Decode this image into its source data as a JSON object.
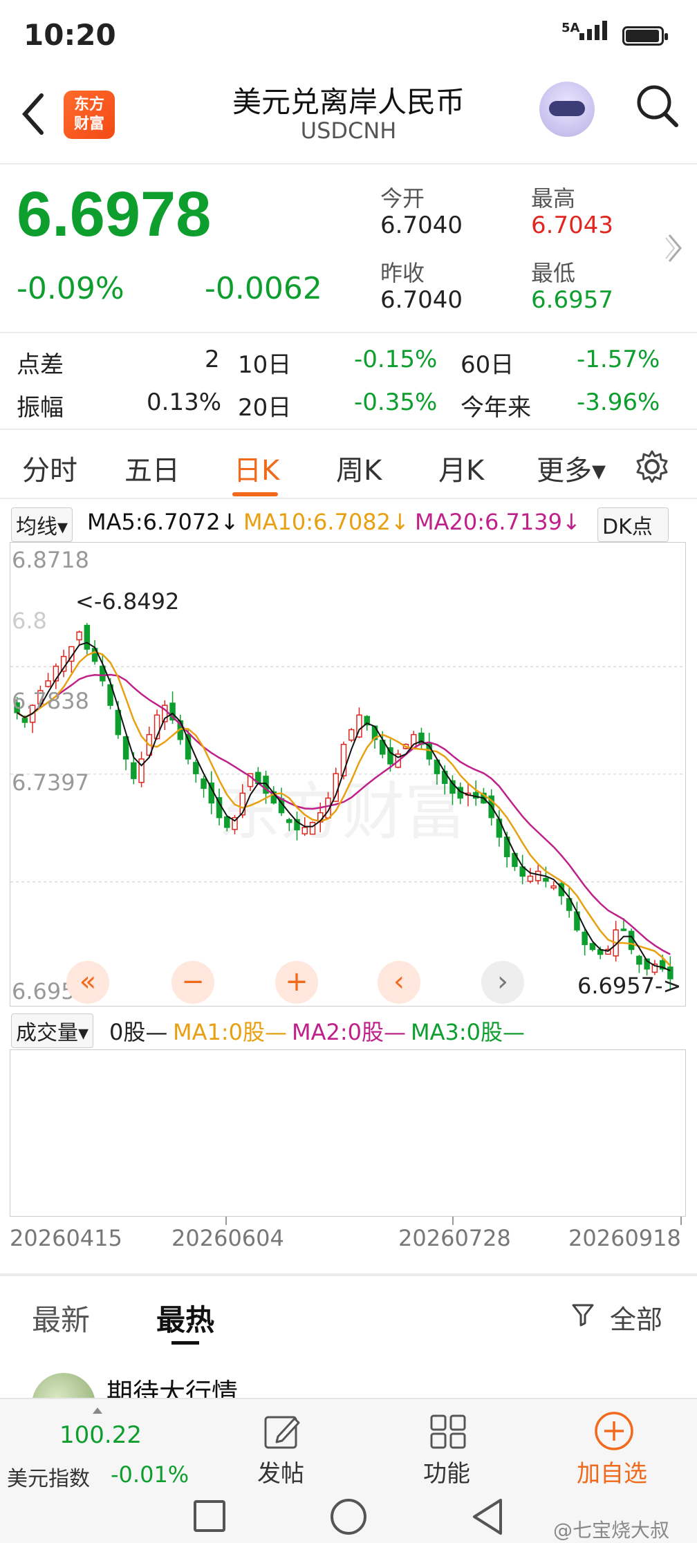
{
  "status_bar": {
    "time": "10:20",
    "network": "5A"
  },
  "header": {
    "logo_line1": "东方",
    "logo_line2": "财富",
    "title": "美元兑离岸人民币",
    "subtitle": "USDCNH"
  },
  "quote": {
    "price": "6.6978",
    "change_pct": "-0.09%",
    "change_abs": "-0.0062",
    "open_label": "今开",
    "open_value": "6.7040",
    "high_label": "最高",
    "high_value": "6.7043",
    "prev_close_label": "昨收",
    "prev_close_value": "6.7040",
    "low_label": "最低",
    "low_value": "6.6957"
  },
  "stats": {
    "spread_label": "点差",
    "spread_value": "2",
    "d10_label": "10日",
    "d10_value": "-0.15%",
    "d60_label": "60日",
    "d60_value": "-1.57%",
    "amp_label": "振幅",
    "amp_value": "0.13%",
    "d20_label": "20日",
    "d20_value": "-0.35%",
    "ytd_label": "今年来",
    "ytd_value": "-3.96%"
  },
  "tabs": [
    "分时",
    "五日",
    "日K",
    "周K",
    "月K",
    "更多▾"
  ],
  "ma_bar": {
    "selector": "均线▾",
    "ma5": "MA5:6.7072↓",
    "ma10": "MA10:6.7082↓",
    "ma20": "MA20:6.7139↓",
    "dk": "DK点"
  },
  "chart_labels": {
    "y_top": "6.8718",
    "y_mid_hidden": "6.8",
    "y_2": "6.7838",
    "y_3": "6.7397",
    "y_bottom": "6.6957",
    "max_marker": "<-6.8492",
    "min_marker": "6.6957->",
    "watermark": "东方财富"
  },
  "chart_controls": [
    "«",
    "−",
    "+",
    "‹",
    "›"
  ],
  "volume_bar": {
    "selector": "成交量▾",
    "vol": "0股—",
    "ma1": "MA1:0股—",
    "ma2": "MA2:0股—",
    "ma3": "MA3:0股—"
  },
  "x_dates": [
    "20260415",
    "20260604",
    "20260728",
    "20260918"
  ],
  "feed": {
    "latest": "最新",
    "hot": "最热",
    "filter": "全部",
    "post_title": "期待大行情"
  },
  "bottom_bar": {
    "index_value": "100.22",
    "index_name": "美元指数",
    "index_change": "-0.01%",
    "post": "发帖",
    "func": "功能",
    "add": "加自选"
  },
  "watermark_credit": "@七宝烧大叔",
  "colors": {
    "up": "#e0271f",
    "down": "#0d9e2e",
    "ma5": "#111111",
    "ma10": "#e8a010",
    "ma20": "#c0208a",
    "accent": "#f1691b"
  },
  "chart_data": {
    "type": "candlestick",
    "x_range": [
      "20260415",
      "20260918"
    ],
    "ylim": [
      6.6957,
      6.8718
    ],
    "y_ticks": [
      6.8718,
      6.8278,
      6.7838,
      6.7397,
      6.6957
    ],
    "ma_last": {
      "MA5": 6.7072,
      "MA10": 6.7082,
      "MA20": 6.7139
    },
    "series_approx_close": [
      6.809,
      6.805,
      6.812,
      6.818,
      6.822,
      6.828,
      6.832,
      6.836,
      6.842,
      6.835,
      6.83,
      6.822,
      6.812,
      6.8,
      6.79,
      6.782,
      6.79,
      6.8,
      6.808,
      6.812,
      6.806,
      6.798,
      6.79,
      6.784,
      6.778,
      6.772,
      6.766,
      6.762,
      6.766,
      6.776,
      6.784,
      6.78,
      6.776,
      6.772,
      6.768,
      6.764,
      6.761,
      6.762,
      6.764,
      6.768,
      6.774,
      6.784,
      6.796,
      6.802,
      6.808,
      6.804,
      6.798,
      6.792,
      6.788,
      6.792,
      6.796,
      6.8,
      6.796,
      6.79,
      6.784,
      6.78,
      6.776,
      6.774,
      6.776,
      6.774,
      6.772,
      6.766,
      6.758,
      6.75,
      6.746,
      6.742,
      6.742,
      6.744,
      6.74,
      6.738,
      6.734,
      6.728,
      6.72,
      6.714,
      6.712,
      6.71,
      6.712,
      6.72,
      6.72,
      6.712,
      6.706,
      6.704,
      6.706,
      6.704,
      6.7
    ]
  }
}
